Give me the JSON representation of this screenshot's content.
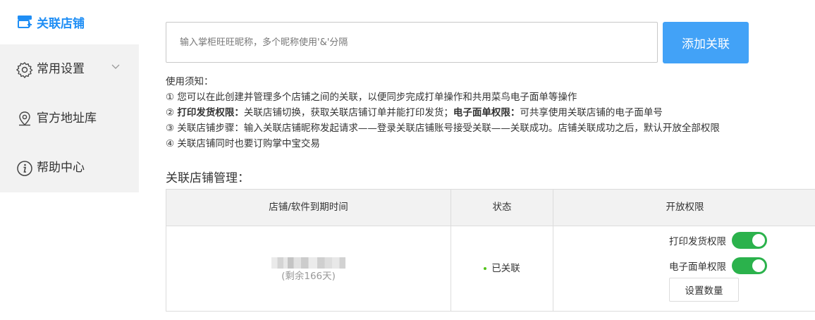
{
  "sidebar": {
    "brand": {
      "label": "关联店铺",
      "icon": "shop-link-icon",
      "color": "#1f8ef5"
    },
    "items": [
      {
        "label": "常用设置",
        "icon": "gear-icon",
        "has_dropdown": true
      },
      {
        "label": "官方地址库",
        "icon": "location-pin-icon"
      },
      {
        "label": "帮助中心",
        "icon": "info-icon"
      }
    ]
  },
  "link_form": {
    "placeholder": "输入掌柜旺旺昵称，多个昵称使用'&'分隔",
    "value": "",
    "add_label": "添加关联",
    "accent": "#42a2f7"
  },
  "notes": {
    "heading": "使用须知：",
    "line1": "① 您可以在此创建并管理多个店铺之间的关联，以便同步完成打单操作和共用菜鸟电子面单等操作",
    "line2_prefix": "② ",
    "line2_bold1": "打印发货权限：",
    "line2_text1": "关联店铺切换，获取关联店铺订单并能打印发货；",
    "line2_bold2": "电子面单权限：",
    "line2_text2": "可共享使用关联店铺的电子面单号",
    "line3": "③ 关联店铺步骤：输入关联店铺昵称发起请求——登录关联店铺账号接受关联——关联成功。店铺关联成功之后，默认开放全部权限",
    "line4": "④ 关联店铺同时也要订购掌中宝交易"
  },
  "section_title": "关联店铺管理：",
  "table": {
    "headers": [
      "店铺/软件到期时间",
      "状态",
      "开放权限"
    ],
    "rows": [
      {
        "remaining": "(剩余166天)",
        "status": "已关联",
        "status_color": "#52c41a",
        "permissions": [
          {
            "label": "打印发货权限",
            "enabled": true
          },
          {
            "label": "电子面单权限",
            "enabled": true
          }
        ],
        "set_qty_label": "设置数量"
      }
    ]
  },
  "toggle_color": "#2bb24c"
}
